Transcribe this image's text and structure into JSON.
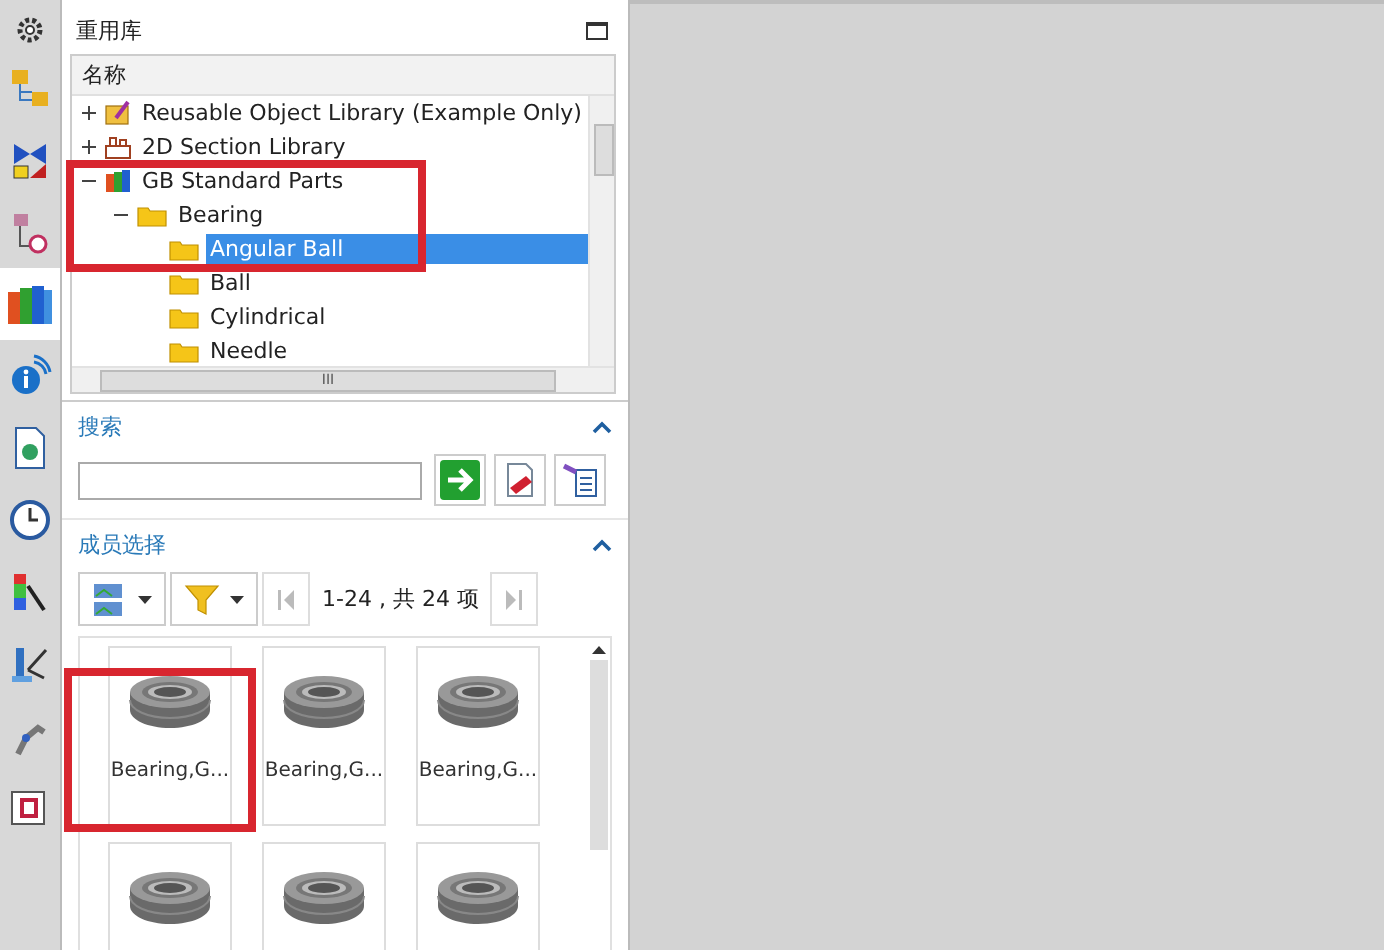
{
  "tools": [
    {
      "kind": "gear",
      "selected": false
    },
    {
      "kind": "assembly",
      "selected": false
    },
    {
      "kind": "constraint",
      "selected": false
    },
    {
      "kind": "navigator",
      "selected": false
    },
    {
      "kind": "library",
      "selected": true
    },
    {
      "kind": "info",
      "selected": false
    },
    {
      "kind": "document",
      "selected": false
    },
    {
      "kind": "history",
      "selected": false
    },
    {
      "kind": "analysis",
      "selected": false
    },
    {
      "kind": "motion",
      "selected": false
    },
    {
      "kind": "robot",
      "selected": false
    },
    {
      "kind": "palette",
      "selected": false
    }
  ],
  "panel": {
    "title": "重用库"
  },
  "tree": {
    "column": "名称",
    "items": [
      {
        "label": "Reusable Object Library (Example Only)",
        "kind": "library",
        "expanded": false,
        "selected": false
      },
      {
        "label": "2D Section Library",
        "kind": "section",
        "expanded": false,
        "selected": false
      },
      {
        "label": "GB Standard Parts",
        "kind": "parts",
        "expanded": true,
        "selected": false,
        "children": [
          {
            "label": "Bearing",
            "kind": "folder",
            "expanded": true,
            "selected": false,
            "children": [
              {
                "label": "Angular Ball",
                "kind": "folder",
                "selected": true
              },
              {
                "label": "Ball",
                "kind": "folder",
                "selected": false
              },
              {
                "label": "Cylindrical",
                "kind": "folder",
                "selected": false
              },
              {
                "label": "Needle",
                "kind": "folder",
                "selected": false
              }
            ]
          }
        ]
      }
    ],
    "h_scroll_grip": "III"
  },
  "search": {
    "title": "搜索",
    "expanded": true
  },
  "members": {
    "title": "成员选择",
    "expanded": true,
    "pager": "1-24 , 共 24 项",
    "cards": [
      {
        "kind": "bearing",
        "label": "Bearing,G..."
      },
      {
        "kind": "bearing",
        "label": "Bearing,G..."
      },
      {
        "kind": "bearing",
        "label": "Bearing,G..."
      },
      {
        "kind": "bearing"
      },
      {
        "kind": "bearing"
      },
      {
        "kind": "bearing"
      }
    ]
  }
}
